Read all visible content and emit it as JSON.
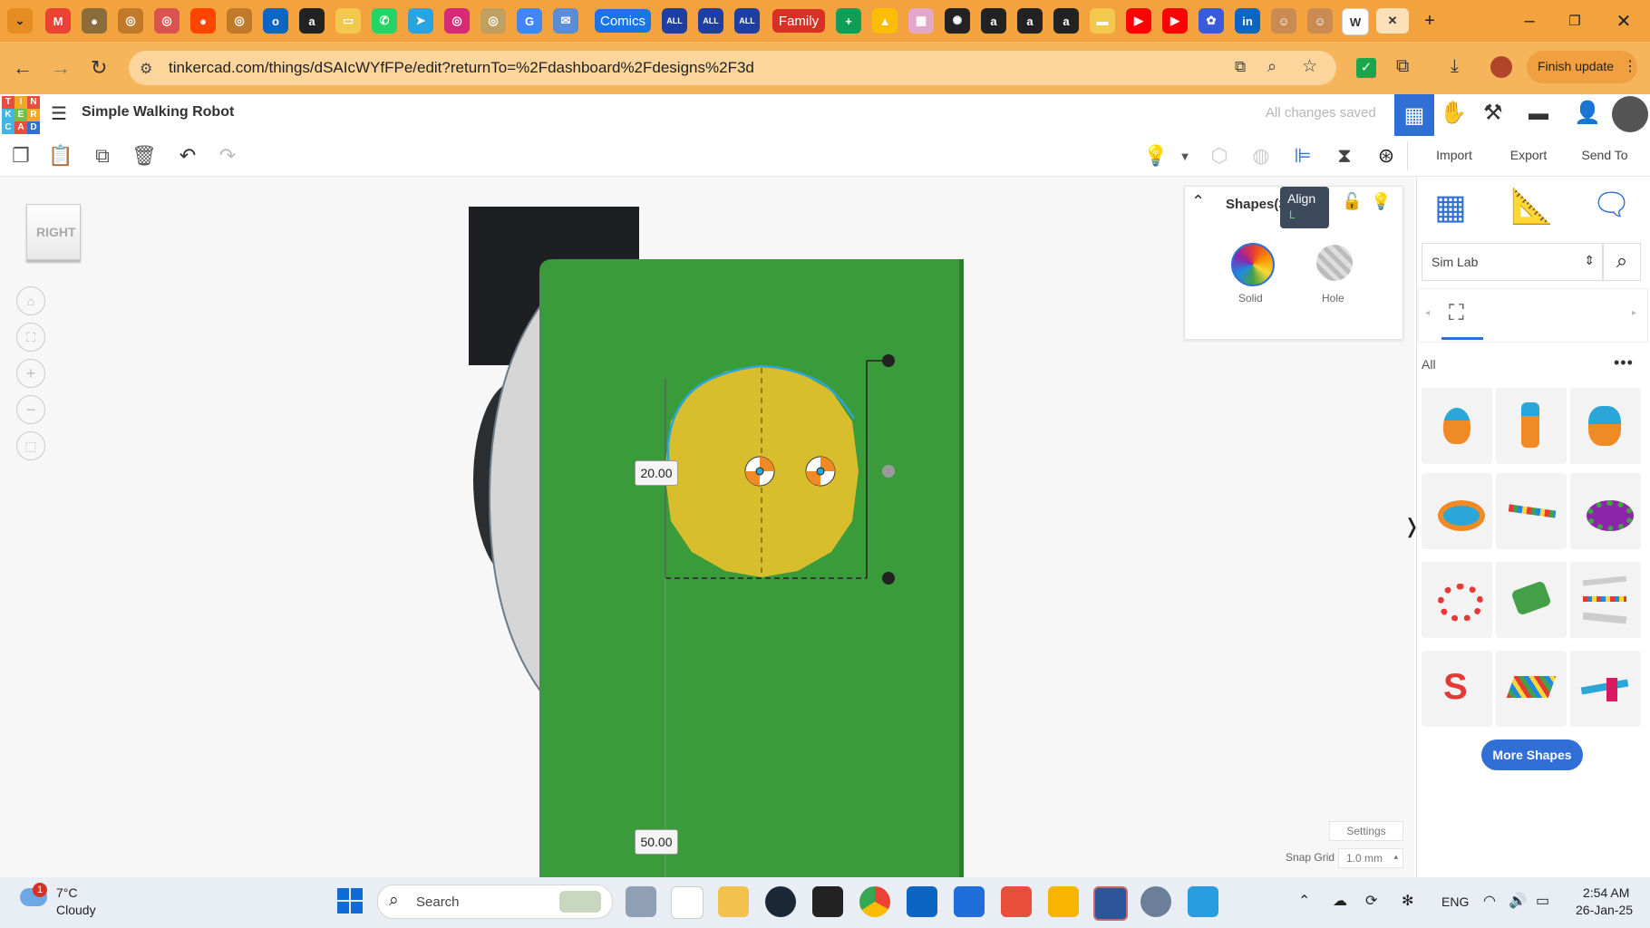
{
  "browser": {
    "tabs_visible": [
      {
        "label": "Comics",
        "color": "#1a73e8"
      },
      {
        "label": "Family",
        "color": "#d93025"
      }
    ],
    "url": "tinkercad.com/things/dSAIcWYfFPe/edit?returnTo=%2Fdashboard%2Fdesigns%2F3d",
    "finish_update_label": "Finish update"
  },
  "app": {
    "logo_letters": [
      "T",
      "I",
      "N",
      "K",
      "E",
      "R",
      "C",
      "A",
      "D"
    ],
    "design_title": "Simple Walking Robot",
    "save_status": "All changes saved"
  },
  "toolbar": {
    "import_label": "Import",
    "export_label": "Export",
    "send_to_label": "Send To",
    "tooltip_title": "Align",
    "tooltip_shortcut": "L"
  },
  "viewcube": {
    "face_label": "RIGHT"
  },
  "shape_inspector": {
    "title": "Shapes(3",
    "solid_label": "Solid",
    "hole_label": "Hole"
  },
  "dimensions": {
    "height_value": "20.00",
    "offset_value": "50.00"
  },
  "right_panel": {
    "library_select": "Sim Lab",
    "category_label": "All",
    "more_shapes_label": "More Shapes",
    "settings_label": "Settings",
    "snap_grid_label": "Snap Grid",
    "snap_grid_value": "1.0 mm"
  },
  "taskbar": {
    "weather_temp": "7°C",
    "weather_desc": "Cloudy",
    "weather_badge": "1",
    "search_placeholder": "Search",
    "language": "ENG",
    "time": "2:54 AM",
    "date": "26-Jan-25"
  },
  "colors": {
    "green_body": "#3a9b3b",
    "yellow_cylinder": "#d8bd2c",
    "accent_blue": "#2f6fd6",
    "chrome_orange": "#f4a23d"
  }
}
